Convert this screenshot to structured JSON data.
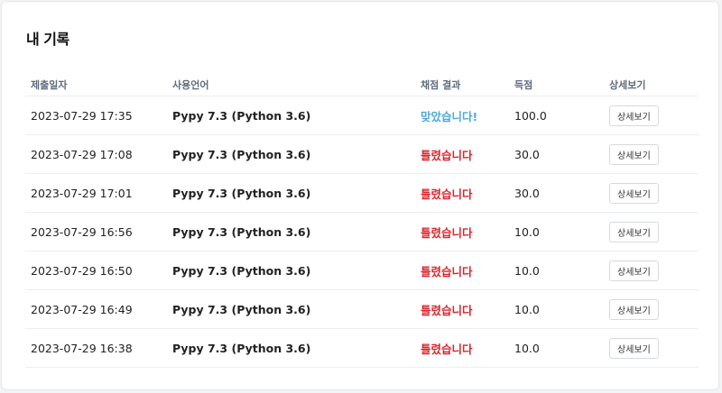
{
  "page": {
    "title": "내 기록"
  },
  "table": {
    "headers": {
      "date": "제출일자",
      "language": "사용언어",
      "result": "채점 결과",
      "score": "득점",
      "detail": "상세보기"
    },
    "rows": [
      {
        "date": "2023-07-29 17:35",
        "language": "Pypy 7.3 (Python 3.6)",
        "result": "맞았습니다!",
        "status": "ok",
        "score": "100.0",
        "button": "상세보기"
      },
      {
        "date": "2023-07-29 17:08",
        "language": "Pypy 7.3 (Python 3.6)",
        "result": "틀렸습니다",
        "status": "fail",
        "score": "30.0",
        "button": "상세보기"
      },
      {
        "date": "2023-07-29 17:01",
        "language": "Pypy 7.3 (Python 3.6)",
        "result": "틀렸습니다",
        "status": "fail",
        "score": "30.0",
        "button": "상세보기"
      },
      {
        "date": "2023-07-29 16:56",
        "language": "Pypy 7.3 (Python 3.6)",
        "result": "틀렸습니다",
        "status": "fail",
        "score": "10.0",
        "button": "상세보기"
      },
      {
        "date": "2023-07-29 16:50",
        "language": "Pypy 7.3 (Python 3.6)",
        "result": "틀렸습니다",
        "status": "fail",
        "score": "10.0",
        "button": "상세보기"
      },
      {
        "date": "2023-07-29 16:49",
        "language": "Pypy 7.3 (Python 3.6)",
        "result": "틀렸습니다",
        "status": "fail",
        "score": "10.0",
        "button": "상세보기"
      },
      {
        "date": "2023-07-29 16:38",
        "language": "Pypy 7.3 (Python 3.6)",
        "result": "틀렸습니다",
        "status": "fail",
        "score": "10.0",
        "button": "상세보기"
      }
    ]
  },
  "colors": {
    "ok": "#4ea9d8",
    "fail": "#d9262c"
  }
}
